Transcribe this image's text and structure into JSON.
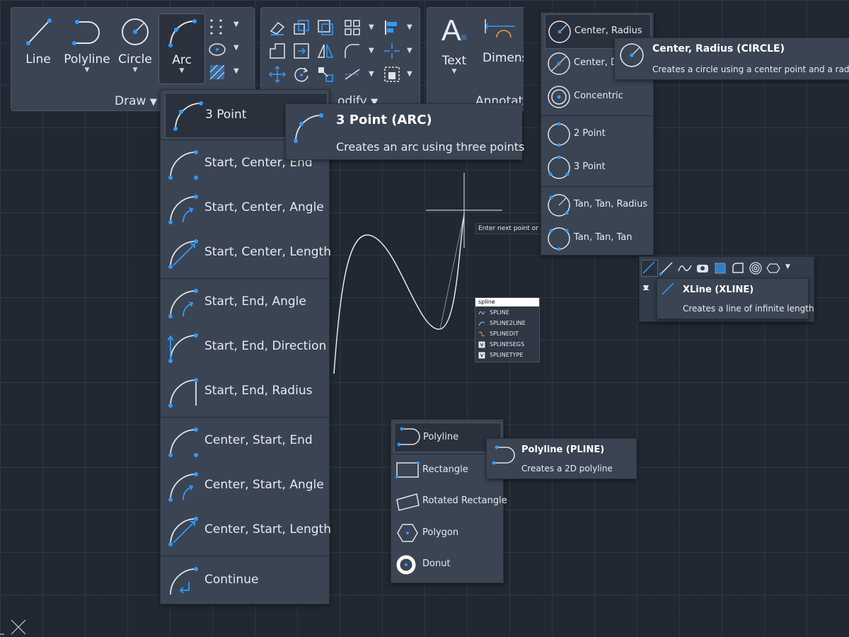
{
  "ribbon": {
    "draw_tools": [
      "Line",
      "Polyline",
      "Circle",
      "Arc"
    ],
    "draw_panel_label": "Draw",
    "modify_panel_label": "odify",
    "annotation_tools": [
      "Text",
      "Dimens"
    ],
    "annotation_panel_label": "Annotati"
  },
  "arc_menu": {
    "items": [
      "3 Point",
      "Start, Center, End",
      "Start, Center, Angle",
      "Start, Center, Length",
      "Start, End, Angle",
      "Start, End, Direction",
      "Start, End, Radius",
      "Center, Start, End",
      "Center, Start, Angle",
      "Center, Start, Length",
      "Continue"
    ]
  },
  "arc_tooltip": {
    "title": "3 Point (ARC)",
    "description": "Creates an arc using three points"
  },
  "circle_menu": {
    "items": [
      "Center, Radius",
      "Center, D",
      "Concentric",
      "2 Point",
      "3 Point",
      "Tan, Tan, Radius",
      "Tan, Tan, Tan"
    ]
  },
  "circle_tooltip": {
    "title": "Center, Radius (CIRCLE)",
    "description": "Creates a circle using a center point and a radiu"
  },
  "xline_tooltip": {
    "title": "XLine (XLINE)",
    "description": "Creates a line of infinite length"
  },
  "cursor_prompt": "Enter next point or",
  "autocomplete": {
    "input": "spline",
    "items": [
      "SPLINE",
      "SPLINE2LINE",
      "SPLINEDIT",
      "SPLINESEGS",
      "SPLINETYPE"
    ]
  },
  "polyline_menu": {
    "items": [
      "Polyline",
      "Rectangle",
      "Rotated Rectangle",
      "Polygon",
      "Donut"
    ]
  },
  "polyline_tooltip": {
    "title": "Polyline (PLINE)",
    "description": "Creates a 2D polyline"
  },
  "colors": {
    "accent": "#2f9bff",
    "panel": "#3b4453",
    "canvas": "#212832"
  }
}
